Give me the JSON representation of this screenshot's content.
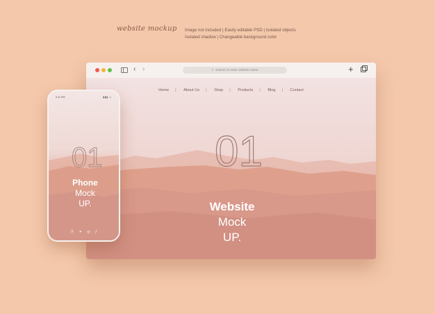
{
  "header": {
    "script_title": "website mockup",
    "lines": [
      "Image not included  |  Easily editable PSD  |  Isolated objects",
      "Isolated shadow  |  Changeable background color"
    ]
  },
  "browser": {
    "url_placeholder": "Search or enter website name",
    "nav": [
      "Home",
      "About Us",
      "Shop",
      "Products",
      "Blog",
      "Contact"
    ],
    "hero_number": "01",
    "title_line1": "Website",
    "title_line2": "Mock",
    "title_line3": "UP."
  },
  "phone": {
    "status_time": "9:41 PM",
    "hero_number": "01",
    "title_line1": "Phone",
    "title_line2": "Mock",
    "title_line3": "UP.",
    "social_icons": [
      "pinterest-icon",
      "twitter-icon",
      "instagram-icon",
      "facebook-icon"
    ]
  }
}
